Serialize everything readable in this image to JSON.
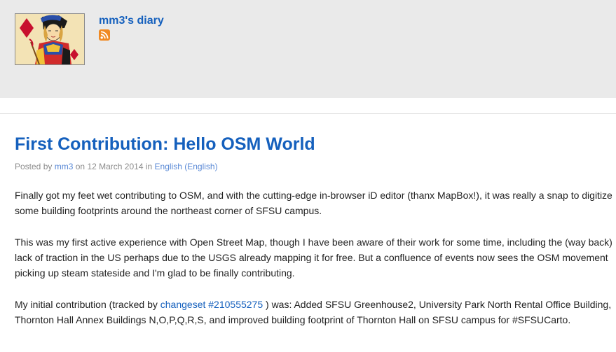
{
  "header": {
    "diary_title": "mm3's diary"
  },
  "post": {
    "title": "First Contribution: Hello OSM World",
    "meta": {
      "posted_by": "Posted by",
      "author": "mm3",
      "on": "on",
      "date": "12 March 2014",
      "in": "in",
      "language": "English (English)"
    },
    "paragraphs": [
      "Finally got my feet wet contributing to OSM, and with the cutting-edge in-browser iD editor (thanx MapBox!), it was really a snap to digitize some building footprints around the northeast corner of SFSU campus.",
      "This was my first active experience with Open Street Map, though I have been aware of their work for some time, including the (way back) lack of traction in the US perhaps due to the USGS already mapping it for free. But a confluence of events now sees the OSM movement picking up steam stateside and I'm glad to be finally contributing."
    ],
    "p3": {
      "before": "My initial contribution (tracked by ",
      "link": "changeset #210555275",
      "after": " ) was: Added SFSU Greenhouse2, University Park North Rental Office Building, Thornton Hall Annex Buildings N,O,P,Q,R,S, and improved building footprint of Thornton Hall on SFSU campus for #SFSUCarto."
    }
  },
  "colors": {
    "link": "#1560bd",
    "header_bg": "#eaeaea",
    "meta_text": "#8c8c8c",
    "rss": "#f08a24"
  },
  "icons": {
    "avatar": "jack-of-diamonds-card-avatar",
    "feed": "rss-icon"
  }
}
